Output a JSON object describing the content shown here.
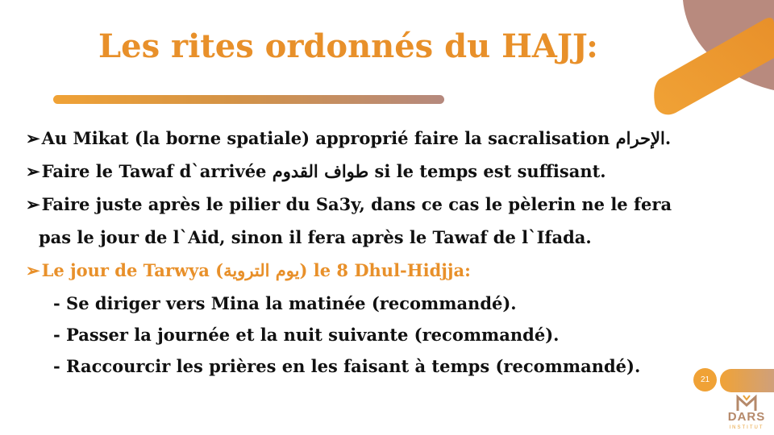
{
  "slide": {
    "title": "Les rites ordonnés du HAJJ:",
    "bullet_symbol": "➢",
    "page_number": "21"
  },
  "lines": [
    {
      "parts": [
        "Au Mikat (la borne spatiale) approprié faire la sacralisation ",
        "الإحرام",
        "."
      ]
    },
    {
      "parts": [
        "Faire le Tawaf d`arrivée ",
        "طواف القدوم",
        " si le temps est suffisant."
      ]
    },
    {
      "text": "Faire juste après le pilier du Sa3y, dans ce cas le pèlerin ne le fera"
    },
    {
      "text": "pas le jour de l`Aid, sinon il fera après le Tawaf de l`Ifada."
    },
    {
      "parts": [
        "Le jour de Tarwya (",
        "يوم التروية",
        ") le 8 Dhul-Hidjja:"
      ]
    },
    {
      "text": "- Se diriger vers Mina la matinée (recommandé)."
    },
    {
      "text": "- Passer la journée et la nuit suivante (recommandé)."
    },
    {
      "text": "- Raccourcir les prières en les faisant à temps (recommandé)."
    }
  ],
  "logo": {
    "word": "DARS",
    "subtitle": "INSTITUT"
  },
  "colors": {
    "accent_orange": "#E8902A",
    "accent_light_orange": "#F0A236",
    "accent_brown": "#B5897E",
    "body_text": "#111111"
  }
}
